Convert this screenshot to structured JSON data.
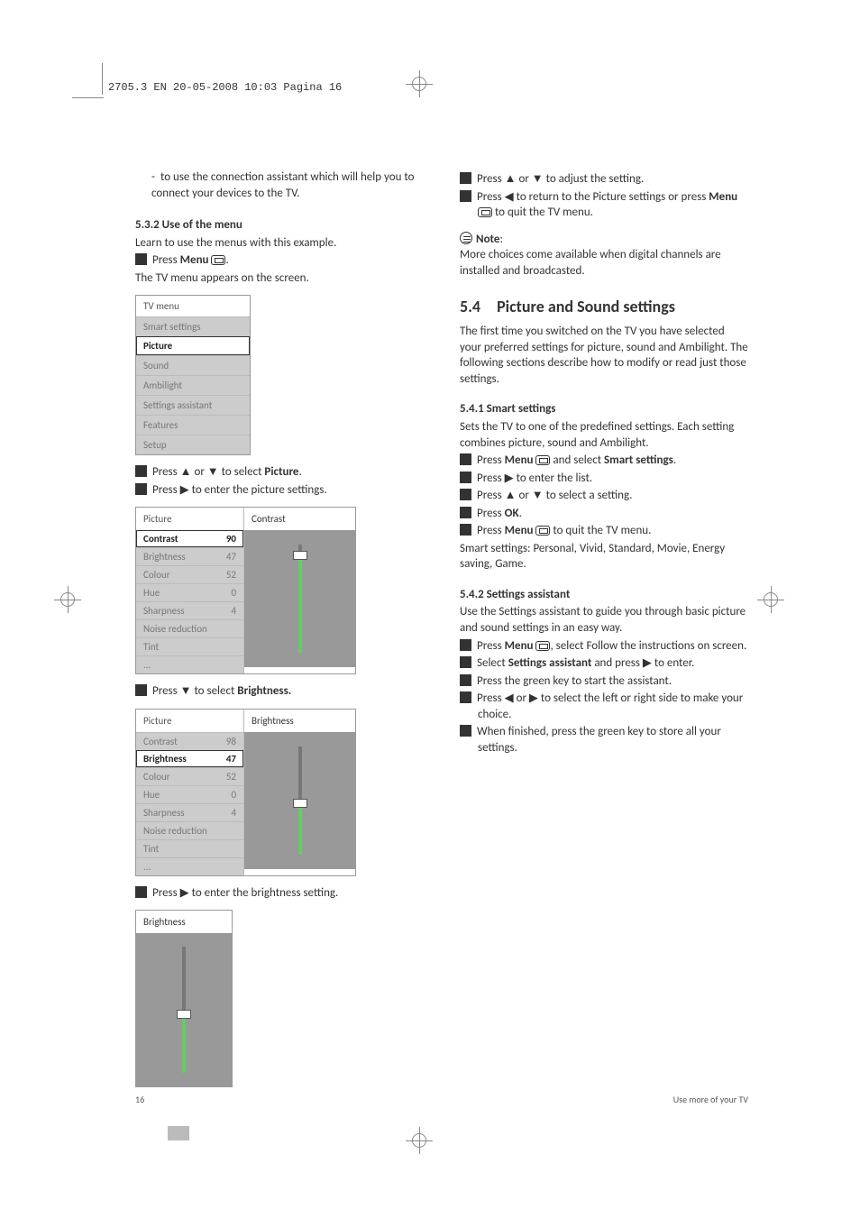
{
  "header": "2705.3 EN  20-05-2008  10:03  Pagina 16",
  "left": {
    "intro_bullet": "to use the connection assistant which will help you to connect your devices to the TV.",
    "s532_heading": "5.3.2   Use of the menu",
    "s532_intro": "Learn to use the menus with this example.",
    "step1_a": "Press ",
    "step1_b": "Menu",
    "step1_c": ".",
    "step1_result": "The TV menu appears on the screen.",
    "tvmenu": {
      "title": "TV menu",
      "items": [
        "Smart settings",
        "Picture",
        "Sound",
        "Ambilight",
        "Settings assistant",
        "Features",
        "Setup"
      ],
      "selected_index": 1
    },
    "step2_a": "Press ▲ or ▼ to select ",
    "step2_b": "Picture",
    "step2_c": ".",
    "step3": "Press ▶ to enter the picture settings.",
    "picmenu1": {
      "left_title": "Picture",
      "right_title": "Contrast",
      "rows": [
        {
          "label": "Contrast",
          "val": "90"
        },
        {
          "label": "Brightness",
          "val": "47"
        },
        {
          "label": "Colour",
          "val": "52"
        },
        {
          "label": "Hue",
          "val": "0"
        },
        {
          "label": "Sharpness",
          "val": "4"
        },
        {
          "label": "Noise reduction",
          "val": ""
        },
        {
          "label": "Tint",
          "val": ""
        },
        {
          "label": "...",
          "val": ""
        }
      ],
      "selected_index": 0,
      "slider_pct": 90
    },
    "step4_a": "Press ▼ to select ",
    "step4_b": "Brightness.",
    "picmenu2": {
      "left_title": "Picture",
      "right_title": "Brightness",
      "rows": [
        {
          "label": "Contrast",
          "val": "98"
        },
        {
          "label": "Brightness",
          "val": "47"
        },
        {
          "label": "Colour",
          "val": "52"
        },
        {
          "label": "Hue",
          "val": "0"
        },
        {
          "label": "Sharpness",
          "val": "4"
        },
        {
          "label": "Noise reduction",
          "val": ""
        },
        {
          "label": "Tint",
          "val": ""
        },
        {
          "label": "...",
          "val": ""
        }
      ],
      "selected_index": 1,
      "slider_pct": 47
    },
    "step5": "Press ▶ to enter the brightness setting.",
    "brightbox": {
      "title": "Brightness",
      "slider_pct": 47
    }
  },
  "right": {
    "step6": "Press ▲ or ▼ to adjust the setting.",
    "step7_a": "Press ◀ to return to the Picture settings or press ",
    "step7_b": "Menu",
    "step7_c": " to quit the TV menu.",
    "note_label": "Note",
    "note_text": "More choices come available when digital channels are installed and broadcasted.",
    "s54_num": "5.4",
    "s54_title": "Picture and Sound settings",
    "s54_intro": "The first time you switched on the TV you have selected your preferred settings for picture, sound and Ambilight. The following sections describe how to modify or read just those settings.",
    "s541_heading": "5.4.1   Smart settings",
    "s541_intro": "Sets the TV to one of the predefined settings. Each setting combines picture, sound and Ambilight.",
    "s541_step1_a": "Press ",
    "s541_step1_b": "Menu",
    "s541_step1_c": " and select ",
    "s541_step1_d": "Smart settings",
    "s541_step1_e": ".",
    "s541_step2": "Press ▶ to enter the list.",
    "s541_step3": "Press ▲ or ▼ to select a setting.",
    "s541_step4_a": "Press ",
    "s541_step4_b": "OK",
    "s541_step4_c": ".",
    "s541_step5_a": "Press ",
    "s541_step5_b": "Menu",
    "s541_step5_c": " to quit the TV menu.",
    "s541_list": "Smart settings: Personal, Vivid, Standard, Movie, Energy saving, Game.",
    "s542_heading": "5.4.2   Settings assistant",
    "s542_intro": "Use the Settings assistant to guide you through basic picture and sound settings in an easy way.",
    "s542_step1_a": "Press ",
    "s542_step1_b": "Menu",
    "s542_step1_c": ", select Follow the instructions on screen.",
    "s542_step2_a": "Select ",
    "s542_step2_b": "Settings assistant",
    "s542_step2_c": " and press ▶ to enter.",
    "s542_step3": "Press the green key to start the assistant.",
    "s542_step4": "Press ◀ or ▶ to select the left or right side to make your choice.",
    "s542_step5": "When finished, press the green key to store all your settings."
  },
  "footer": {
    "page": "16",
    "section": "Use more of your TV"
  }
}
